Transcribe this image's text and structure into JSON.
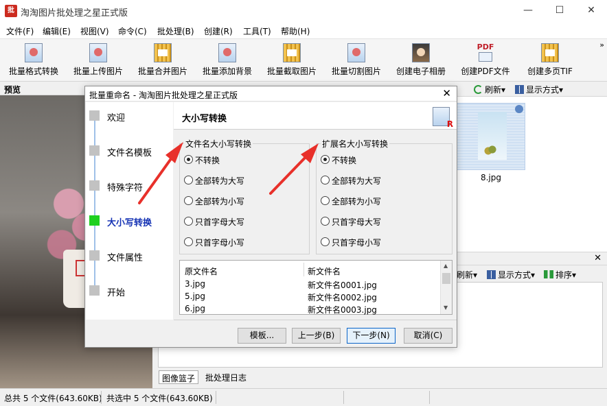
{
  "app": {
    "logo_text": "批",
    "title": "淘淘图片批处理之星正式版",
    "window_controls": {
      "minimize": "—",
      "maximize": "☐",
      "close": "✕"
    }
  },
  "menu": [
    "文件(F)",
    "编辑(E)",
    "视图(V)",
    "命令(C)",
    "批处理(B)",
    "创建(R)",
    "工具(T)",
    "帮助(H)"
  ],
  "toolbar": {
    "buttons": [
      {
        "label": "批量格式转换",
        "icon": "format-convert-icon"
      },
      {
        "label": "批量上传图片",
        "icon": "upload-icon"
      },
      {
        "label": "批量合并图片",
        "icon": "merge-icon"
      },
      {
        "label": "批量添加背景",
        "icon": "background-icon"
      },
      {
        "label": "批量截取图片",
        "icon": "crop-icon"
      },
      {
        "label": "批量切割图片",
        "icon": "cut-icon"
      },
      {
        "label": "创建电子相册",
        "icon": "album-icon"
      },
      {
        "label": "创建PDF文件",
        "icon": "pdf-icon"
      },
      {
        "label": "创建多页TIF",
        "icon": "tif-icon"
      }
    ],
    "pdf_text": "PDF",
    "more": "»"
  },
  "preview": {
    "title": "预览"
  },
  "right_panel": {
    "refresh": "刷新",
    "view_mode": "显示方式",
    "thumbnail_label": "8.jpg"
  },
  "lower_panel": {
    "close": "✕",
    "refresh": "刷新",
    "view_mode": "显示方式",
    "sort": "排序",
    "tabs": [
      "图像篮子",
      "批处理日志"
    ]
  },
  "status": {
    "total": "总共 5 个文件(643.60KB)",
    "selected": "共选中 5 个文件(643.60KB)"
  },
  "dialog": {
    "title": "批量重命名 - 淘淘图片批处理之星正式版",
    "close": "✕",
    "steps": [
      {
        "label": "欢迎",
        "active": false
      },
      {
        "label": "文件名模板",
        "active": false
      },
      {
        "label": "特殊字符",
        "active": false
      },
      {
        "label": "大小写转换",
        "active": true
      },
      {
        "label": "文件属性",
        "active": false
      },
      {
        "label": "开始",
        "active": false
      }
    ],
    "header_title": "大小写转换",
    "filename_group": {
      "title": "文件名大小写转换",
      "options": [
        "不转换",
        "全部转为大写",
        "全部转为小写",
        "只首字母大写",
        "只首字母小写"
      ],
      "selected": "不转换"
    },
    "ext_group": {
      "title": "扩展名大小写转换",
      "options": [
        "不转换",
        "全部转为大写",
        "全部转为小写",
        "只首字母大写",
        "只首字母小写"
      ],
      "selected": "不转换"
    },
    "list": {
      "columns": [
        "原文件名",
        "新文件名"
      ],
      "rows": [
        [
          "3.jpg",
          "新文件名0001.jpg"
        ],
        [
          "5.jpg",
          "新文件名0002.jpg"
        ],
        [
          "6.jpg",
          "新文件名0003.jpg"
        ]
      ]
    },
    "buttons": {
      "template": "模板...",
      "prev": "上一步(B)",
      "next": "下一步(N)",
      "cancel": "取消(C)"
    }
  },
  "colors": {
    "active_step": "#1fd01f",
    "active_step_text": "#1432b4",
    "annotation_arrow": "#e8302a",
    "logo": "#cc2b1f"
  }
}
